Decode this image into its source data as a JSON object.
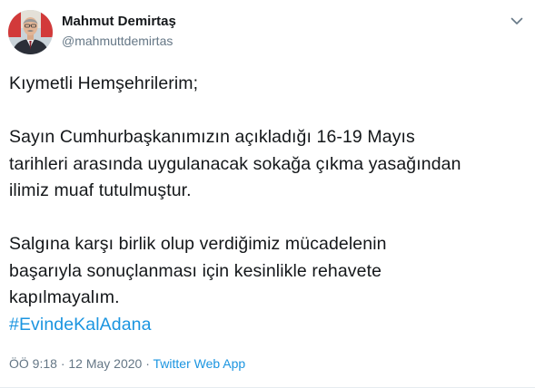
{
  "author": {
    "name": "Mahmut Demirtaş",
    "handle": "@mahmuttdemirtas"
  },
  "tweet": {
    "lines_p1": [
      "Kıymetli Hemşehrilerim;"
    ],
    "lines_p2": [
      "Sayın Cumhurbaşkanımızın açıkladığı 16-19 Mayıs",
      "tarihleri arasında uygulanacak sokağa çıkma yasağından",
      "ilimiz muaf tutulmuştur."
    ],
    "lines_p3": [
      "Salgına karşı birlik olup verdiğimiz mücadelenin",
      "başarıyla sonuçlanması için kesinlikle rehavete",
      "kapılmayalım."
    ],
    "hashtag": "#EvindeKalAdana"
  },
  "meta": {
    "time": "ÖÖ 9:18",
    "separator": "·",
    "date": "12 May 2020",
    "source": "Twitter Web App"
  },
  "colors": {
    "link": "#1b95e0",
    "secondary": "#657786",
    "text": "#14171a"
  },
  "icons": {
    "caret": "chevron-down-icon",
    "avatar": "profile-photo"
  }
}
